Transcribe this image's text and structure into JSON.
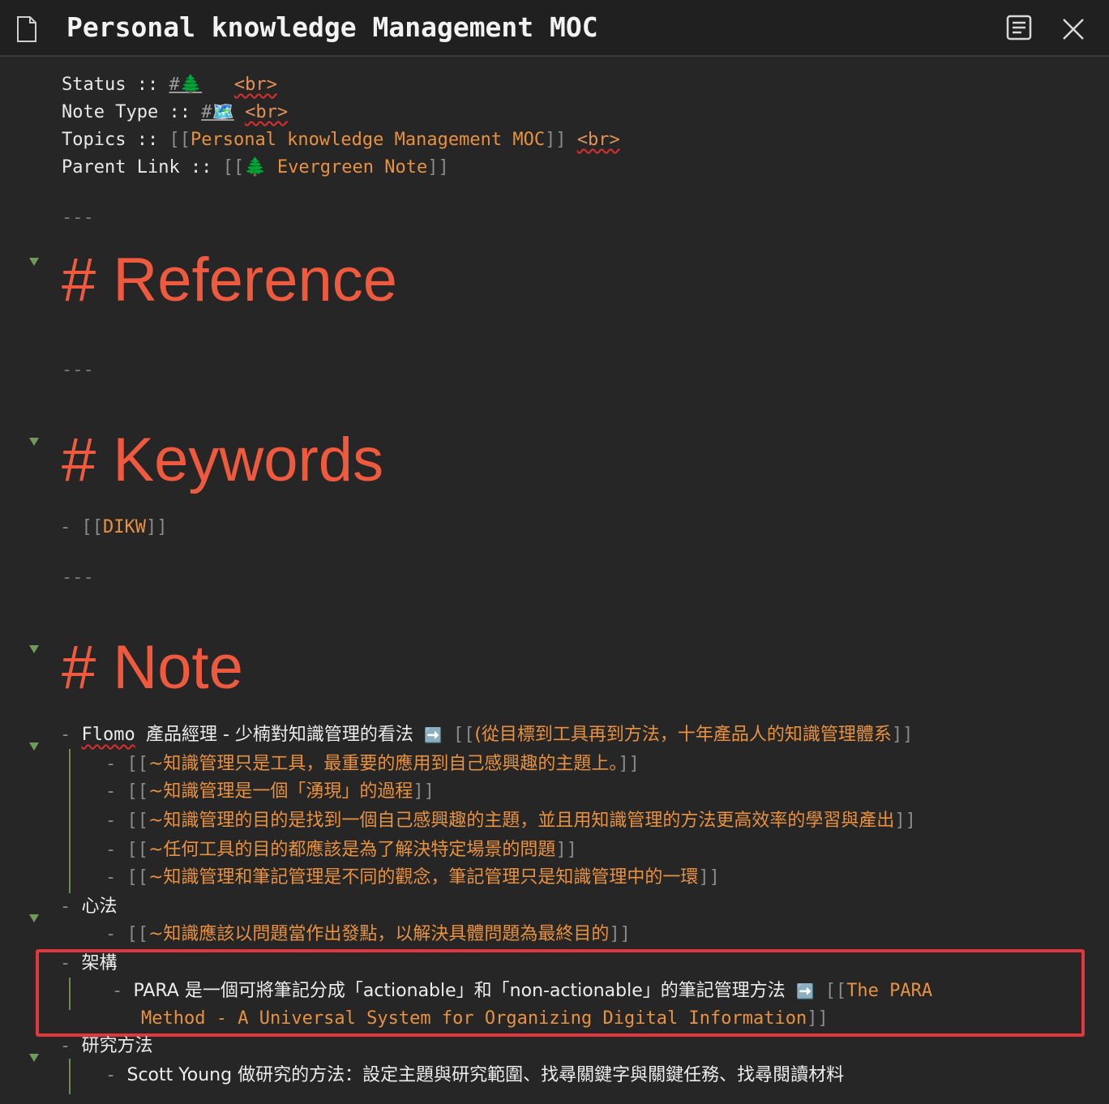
{
  "window": {
    "title": "Personal knowledge Management MOC",
    "icons": {
      "file": "file-icon",
      "reader": "reading-view-icon",
      "close": "close-icon"
    }
  },
  "frontmatter": {
    "status_key": "Status ::",
    "status_tag": "#🌲",
    "status_br": "<br>",
    "notetype_key": "Note Type ::",
    "notetype_tag": "#🗺️",
    "notetype_br": "<br>",
    "topics_key": "Topics ::",
    "topics_open": "[[",
    "topics_link": "Personal knowledge Management MOC",
    "topics_close": "]]",
    "topics_br": "<br>",
    "parent_key": "Parent Link ::",
    "parent_open": "[[🌲",
    "parent_link": "Evergreen Note",
    "parent_close": "]]"
  },
  "hr": "---",
  "headings": {
    "reference": "# Reference",
    "keywords": "# Keywords",
    "note": "# Note"
  },
  "keywords_list": {
    "dash": "-",
    "open": "[[",
    "link": "DIKW",
    "close": "]]"
  },
  "note_list": {
    "dash": "-",
    "open": "[[",
    "close": "]]",
    "flomo": {
      "brand": "Flomo",
      "text": "產品經理 - 少楠對知識管理的看法",
      "arrow": "➡️",
      "link": "(從目標到工具再到方法，十年產品人的知識管理體系",
      "children": [
        "~知識管理只是工具，最重要的應用到自己感興趣的主題上。",
        "~知識管理是一個「湧現」的過程",
        "~知識管理的目的是找到一個自己感興趣的主題，並且用知識管理的方法更高效率的學習與產出",
        "~任何工具的目的都應該是為了解決特定場景的問題",
        "~知識管理和筆記管理是不同的觀念，筆記管理只是知識管理中的一環"
      ]
    },
    "mindset": {
      "label": "心法",
      "child": "~知識應該以問題當作出發點，以解決具體問題為最終目的"
    },
    "architecture": {
      "label": "架構",
      "text": "PARA 是一個可將筆記分成「actionable」和「non-actionable」的筆記管理方法",
      "arrow": "➡️",
      "link_line1": "The PARA",
      "link_line2": "Method - A Universal System for Organizing Digital Information"
    },
    "research": {
      "label": "研究方法",
      "child": "Scott Young 做研究的方法：設定主題與研究範圍、找尋關鍵字與關鍵任務、找尋閱讀材料"
    }
  },
  "colors": {
    "background": "#262626",
    "heading": "#ef5a3f",
    "link": "#e8913f",
    "highlight_border": "#e0383d",
    "fold_arrow": "#6f9a5a"
  }
}
